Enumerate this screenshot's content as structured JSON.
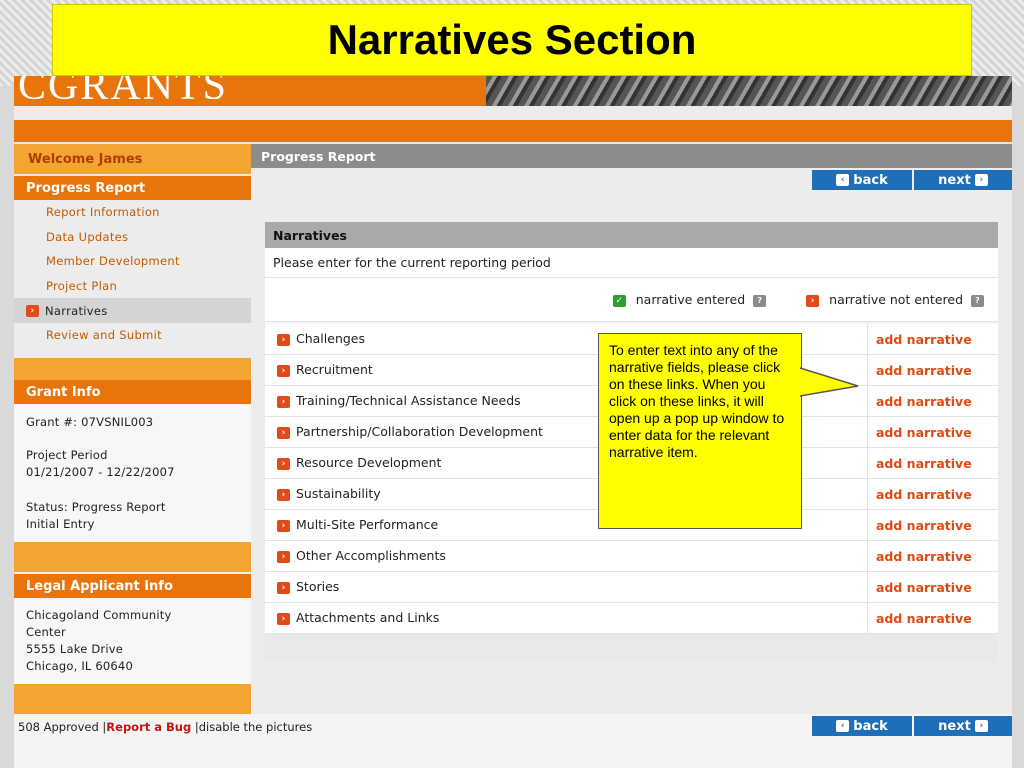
{
  "slide_title": "Narratives Section",
  "header": {
    "logo_text": "CGRANTS"
  },
  "sidebar": {
    "welcome": "Welcome James",
    "progress_report_title": "Progress Report",
    "items": [
      {
        "label": "Report Information"
      },
      {
        "label": "Data Updates"
      },
      {
        "label": "Member Development"
      },
      {
        "label": "Project Plan"
      },
      {
        "label": "Narratives"
      },
      {
        "label": "Review and Submit"
      }
    ],
    "grant_info_title": "Grant Info",
    "grant_number": "Grant #: 07VSNIL003",
    "project_period_label": "Project Period",
    "project_period": "01/21/2007 - 12/22/2007",
    "status_label": "Status: Progress Report",
    "status_value": "Initial Entry",
    "legal_title": "Legal Applicant Info",
    "legal_lines": [
      "Chicagoland Community",
      "Center",
      "5555 Lake Drive",
      "Chicago, IL 60640"
    ]
  },
  "main": {
    "header": "Progress Report",
    "back_label": "back",
    "next_label": "next",
    "panel_title": "Narratives",
    "intro": "Please enter for the current reporting period",
    "legend_entered": "narrative entered",
    "legend_not_entered": "narrative not entered",
    "action_label": "add narrative",
    "rows": [
      {
        "label": "Challenges"
      },
      {
        "label": "Recruitment"
      },
      {
        "label": "Training/Technical Assistance Needs"
      },
      {
        "label": "Partnership/Collaboration Development"
      },
      {
        "label": "Resource Development"
      },
      {
        "label": "Sustainability"
      },
      {
        "label": "Multi-Site Performance"
      },
      {
        "label": "Other Accomplishments"
      },
      {
        "label": "Stories"
      },
      {
        "label": "Attachments and Links"
      }
    ]
  },
  "footer": {
    "approved": "508 Approved",
    "report_bug": "Report a Bug",
    "disable": "disable the pictures"
  },
  "callout": {
    "text": "To enter text into any of the narrative fields, please click on these links.  When you click on these links, it will open up a pop up window to enter data for the relevant narrative item."
  },
  "colors": {
    "orange": "#e8740c",
    "light_orange": "#f2a531",
    "blue": "#1e6fb8",
    "link_red": "#e04a12",
    "highlight": "#ffff00"
  }
}
